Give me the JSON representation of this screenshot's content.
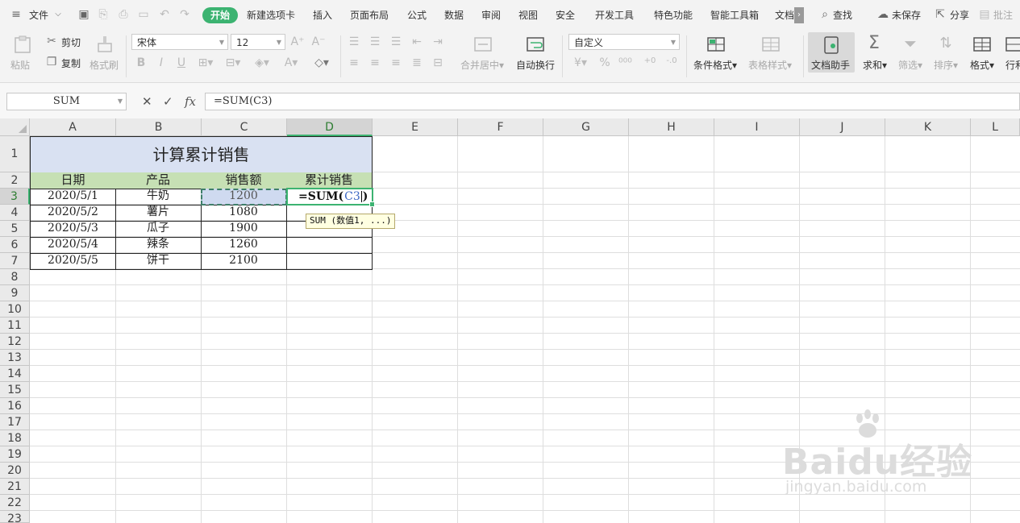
{
  "menu": {
    "file": "文件",
    "tabs": [
      "开始",
      "新建选项卡",
      "插入",
      "页面布局",
      "公式",
      "数据",
      "审阅",
      "视图",
      "安全",
      "开发工具",
      "特色功能",
      "智能工具箱",
      "文档"
    ],
    "search": "查找",
    "unsaved": "未保存",
    "share": "分享",
    "comment": "批注"
  },
  "ribbon": {
    "paste": "粘贴",
    "cut": "剪切",
    "copy": "复制",
    "format_painter": "格式刷",
    "font_name": "宋体",
    "font_size": "12",
    "merge_center": "合并居中",
    "wrap_text": "自动换行",
    "number_format": "自定义",
    "conditional_format": "条件格式",
    "table_style": "表格样式",
    "doc_helper": "文档助手",
    "sum": "求和",
    "filter": "筛选",
    "sort": "排序",
    "format": "格式",
    "rows_cols": "行和"
  },
  "formula_bar": {
    "name_box": "SUM",
    "fx": "fx",
    "formula": "=SUM(C3)"
  },
  "grid": {
    "columns": [
      "A",
      "B",
      "C",
      "D",
      "E",
      "F",
      "G",
      "H",
      "I",
      "J",
      "K",
      "L"
    ],
    "rows": [
      "1",
      "2",
      "3",
      "4",
      "5",
      "6",
      "7",
      "8",
      "9",
      "10",
      "11",
      "12",
      "13",
      "14",
      "15",
      "16",
      "17",
      "18",
      "19",
      "20",
      "21",
      "22",
      "23"
    ],
    "title": "计算累计销售",
    "headers": [
      "日期",
      "产品",
      "销售额",
      "累计销售"
    ],
    "data": [
      [
        "2020/5/1",
        "牛奶",
        "1200"
      ],
      [
        "2020/5/2",
        "薯片",
        "1080"
      ],
      [
        "2020/5/3",
        "瓜子",
        "1900"
      ],
      [
        "2020/5/4",
        "辣条",
        "1260"
      ],
      [
        "2020/5/5",
        "饼干",
        "2100"
      ]
    ],
    "edit_prefix": "=SUM(",
    "edit_ref": "C3",
    "edit_suffix": ")",
    "tooltip": "SUM (数值1, ...)"
  },
  "watermark": {
    "main": "Baidu经验",
    "sub": "jingyan.baidu.com"
  },
  "colors": {
    "accent": "#3cb371",
    "title_fill": "#d9e1f2",
    "header_fill": "#c6e0b4",
    "ref_fill": "#cfdaf0"
  }
}
